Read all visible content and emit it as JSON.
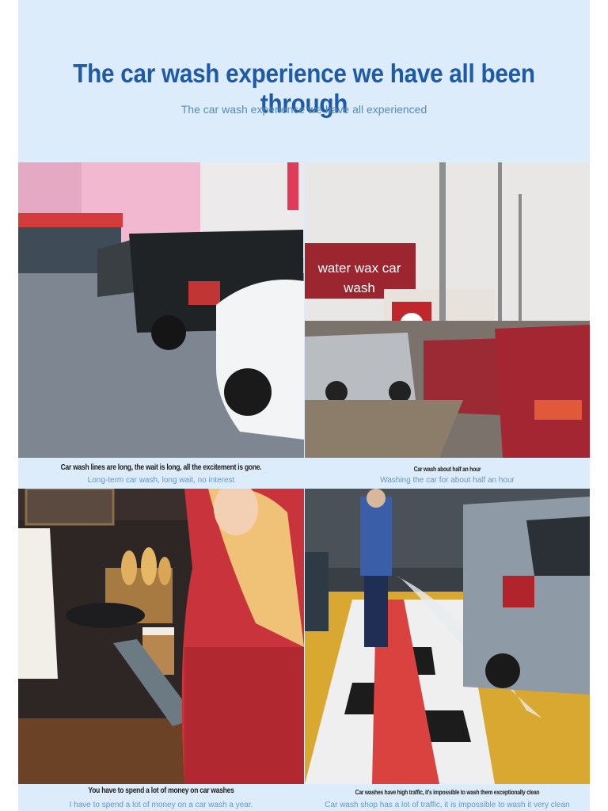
{
  "header": {
    "title": "The car wash experience we have all been through",
    "subtitle": "The car wash experience we have all experienced"
  },
  "panels": [
    {
      "caption": "Car wash lines are long, the wait is long, all the excitement is gone.",
      "sub_caption": "Long-term car wash, long wait, no interest"
    },
    {
      "overlay": "water wax car wash",
      "caption": "Car wash about half an hour",
      "sub_caption": "Washing the car for about half an hour"
    },
    {
      "caption": "You have to spend a lot of money on car washes",
      "sub_caption": "I have to spend a lot of money on a car wash a year."
    },
    {
      "caption": "Car washes have high traffic, it's impossible to wash them exceptionally clean",
      "sub_caption": "Car wash shop has a lot of traffic, it is impossible to wash it very clean"
    }
  ],
  "colors": {
    "background": "#dcecfa",
    "title": "#1f5aa6",
    "subtitle": "#5a8bb0"
  }
}
